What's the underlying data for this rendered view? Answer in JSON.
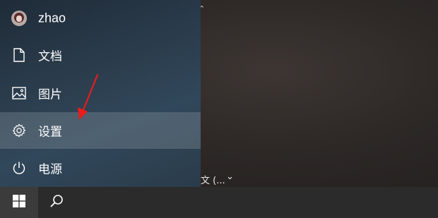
{
  "user": {
    "name": "zhao",
    "icon": "avatar"
  },
  "menu": {
    "items": [
      {
        "label": "文档",
        "icon": "document-icon"
      },
      {
        "label": "图片",
        "icon": "pictures-icon"
      },
      {
        "label": "设置",
        "icon": "gear-icon"
      },
      {
        "label": "电源",
        "icon": "power-icon"
      }
    ]
  },
  "desktop": {
    "language_indicator": "文 (...",
    "language_chevron": "⌄",
    "corner_chevron": "⌃"
  },
  "taskbar": {
    "start_icon": "windows-logo-icon",
    "search_icon": "search-icon"
  },
  "annotation": {
    "arrow_color": "#e81c1c"
  }
}
